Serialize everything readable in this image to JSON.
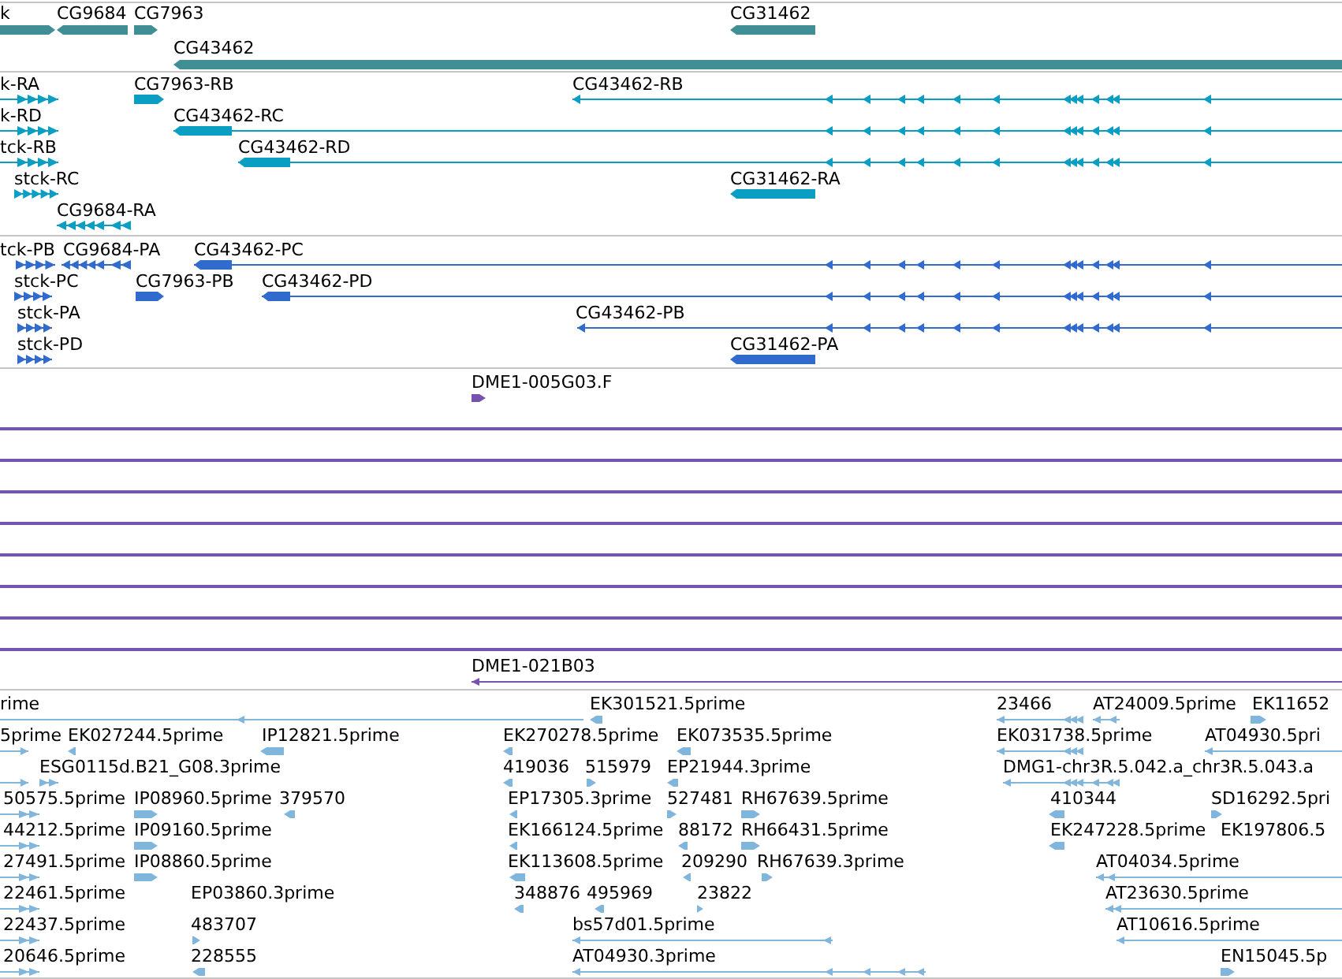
{
  "tracks": [
    {
      "color": "#3f8f94",
      "features": [
        {
          "label": "k",
          "kind": "block",
          "reverse": false
        },
        {
          "label": "CG9684",
          "kind": "block",
          "reverse": true
        },
        {
          "label": "CG7963",
          "kind": "block",
          "reverse": false
        },
        {
          "label": "CG31462",
          "kind": "block",
          "reverse": true
        },
        {
          "label": "CG43462",
          "kind": "block",
          "reverse": true
        }
      ]
    },
    {
      "color": "#0a9ec3",
      "features": [
        {
          "label": "k-RA",
          "kind": "exons",
          "reverse": false
        },
        {
          "label": "CG7963-RB",
          "kind": "block",
          "reverse": false
        },
        {
          "label": "CG43462-RB",
          "kind": "spliced",
          "reverse": true
        },
        {
          "label": "k-RD",
          "kind": "exons",
          "reverse": false
        },
        {
          "label": "CG43462-RC",
          "kind": "spliced",
          "reverse": true
        },
        {
          "label": "tck-RB",
          "kind": "exons",
          "reverse": false
        },
        {
          "label": "CG43462-RD",
          "kind": "spliced",
          "reverse": true
        },
        {
          "label": "stck-RC",
          "kind": "exons",
          "reverse": false
        },
        {
          "label": "CG31462-RA",
          "kind": "block",
          "reverse": true
        },
        {
          "label": "CG9684-RA",
          "kind": "exons",
          "reverse": true
        }
      ]
    },
    {
      "color": "#316bcd",
      "features": [
        {
          "label": "tck-PB",
          "kind": "exons",
          "reverse": false
        },
        {
          "label": "CG9684-PA",
          "kind": "exons",
          "reverse": true
        },
        {
          "label": "CG43462-PC",
          "kind": "spliced",
          "reverse": true
        },
        {
          "label": "stck-PC",
          "kind": "exons",
          "reverse": false
        },
        {
          "label": "CG7963-PB",
          "kind": "block",
          "reverse": false
        },
        {
          "label": "CG43462-PD",
          "kind": "spliced",
          "reverse": true
        },
        {
          "label": "stck-PA",
          "kind": "exons",
          "reverse": false
        },
        {
          "label": "CG43462-PB",
          "kind": "spliced",
          "reverse": true
        },
        {
          "label": "stck-PD",
          "kind": "exons",
          "reverse": false
        },
        {
          "label": "CG31462-PA",
          "kind": "block",
          "reverse": true
        }
      ]
    },
    {
      "color": "#7653ad",
      "features": [
        {
          "label": "DME1-005G03.F",
          "kind": "block",
          "reverse": false
        },
        {
          "kind": "line"
        },
        {
          "kind": "line"
        },
        {
          "kind": "line"
        },
        {
          "kind": "line"
        },
        {
          "kind": "line"
        },
        {
          "kind": "line"
        },
        {
          "kind": "line"
        },
        {
          "kind": "line"
        },
        {
          "label": "DME1-021B03",
          "kind": "spliced",
          "reverse": true
        }
      ]
    },
    {
      "color": "#80b5dc",
      "features": [
        {
          "label": "rime",
          "kind": "spliced",
          "reverse": true
        },
        {
          "label": "EK301521.5prime",
          "kind": "block",
          "reverse": true
        },
        {
          "label": "23466",
          "kind": "spliced",
          "reverse": true
        },
        {
          "label": "AT24009.5prime",
          "kind": "spliced",
          "reverse": true
        },
        {
          "label": "EK11652",
          "kind": "block",
          "reverse": false
        },
        {
          "label": "5prime",
          "kind": "spliced",
          "reverse": false
        },
        {
          "label": "EK027244.5prime",
          "kind": "block",
          "reverse": true
        },
        {
          "label": "IP12821.5prime",
          "kind": "block",
          "reverse": true
        },
        {
          "label": "EK270278.5prime",
          "kind": "block",
          "reverse": true
        },
        {
          "label": "EK073535.5prime",
          "kind": "block",
          "reverse": true
        },
        {
          "label": "EK031738.5prime",
          "kind": "spliced",
          "reverse": true
        },
        {
          "label": "AT04930.5pri",
          "kind": "spliced",
          "reverse": true
        },
        {
          "kind": "spliced",
          "reverse": false
        },
        {
          "label": "ESG0115d.B21_G08.3prime",
          "kind": "exons",
          "reverse": false
        },
        {
          "label": "419036",
          "kind": "block",
          "reverse": true
        },
        {
          "label": "515979",
          "kind": "block",
          "reverse": false
        },
        {
          "label": "EP21944.3prime",
          "kind": "block",
          "reverse": true
        },
        {
          "label": "DMG1-chr3R.5.042.a_chr3R.5.043.a",
          "kind": "spliced",
          "reverse": true
        },
        {
          "label": "50575.5prime",
          "kind": "exons",
          "reverse": false
        },
        {
          "label": "IP08960.5prime",
          "kind": "block",
          "reverse": false
        },
        {
          "label": "379570",
          "kind": "block",
          "reverse": true
        },
        {
          "label": "EP17305.3prime",
          "kind": "block",
          "reverse": true
        },
        {
          "label": "527481",
          "kind": "block",
          "reverse": false
        },
        {
          "label": "RH67639.5prime",
          "kind": "block",
          "reverse": false
        },
        {
          "label": "410344",
          "kind": "block",
          "reverse": true
        },
        {
          "label": "SD16292.5pri",
          "kind": "block",
          "reverse": false
        },
        {
          "label": "44212.5prime",
          "kind": "exons",
          "reverse": false
        },
        {
          "label": "IP09160.5prime",
          "kind": "block",
          "reverse": false
        },
        {
          "label": "EK166124.5prime",
          "kind": "block",
          "reverse": true
        },
        {
          "label": "88172",
          "kind": "block",
          "reverse": true
        },
        {
          "label": "RH66431.5prime",
          "kind": "block",
          "reverse": false
        },
        {
          "label": "EK247228.5prime",
          "kind": "block",
          "reverse": true
        },
        {
          "label": "EK197806.5",
          "kind": "label"
        },
        {
          "label": "27491.5prime",
          "kind": "exons",
          "reverse": false
        },
        {
          "label": "IP08860.5prime",
          "kind": "block",
          "reverse": false
        },
        {
          "label": "EK113608.5prime",
          "kind": "block",
          "reverse": true
        },
        {
          "label": "209290",
          "kind": "block",
          "reverse": true
        },
        {
          "label": "RH67639.3prime",
          "kind": "block",
          "reverse": false
        },
        {
          "label": "AT04034.5prime",
          "kind": "spliced",
          "reverse": true
        },
        {
          "label": "22461.5prime",
          "kind": "exons",
          "reverse": false
        },
        {
          "label": "EP03860.3prime",
          "kind": "label"
        },
        {
          "label": "348876",
          "kind": "block",
          "reverse": true
        },
        {
          "label": "495969",
          "kind": "block",
          "reverse": true
        },
        {
          "label": "23822",
          "kind": "block",
          "reverse": false
        },
        {
          "label": "AT23630.5prime",
          "kind": "spliced",
          "reverse": true
        },
        {
          "label": "22437.5prime",
          "kind": "exons",
          "reverse": false
        },
        {
          "label": "483707",
          "kind": "block",
          "reverse": false
        },
        {
          "label": "bs57d01.5prime",
          "kind": "spliced",
          "reverse": true
        },
        {
          "label": "AT10616.5prime",
          "kind": "spliced",
          "reverse": true
        },
        {
          "label": "20646.5prime",
          "kind": "exons",
          "reverse": false
        },
        {
          "label": "228555",
          "kind": "block",
          "reverse": true
        },
        {
          "label": "AT04930.3prime",
          "kind": "spliced",
          "reverse": true
        },
        {
          "label": "EN15045.5p",
          "kind": "block",
          "reverse": false
        }
      ]
    }
  ]
}
